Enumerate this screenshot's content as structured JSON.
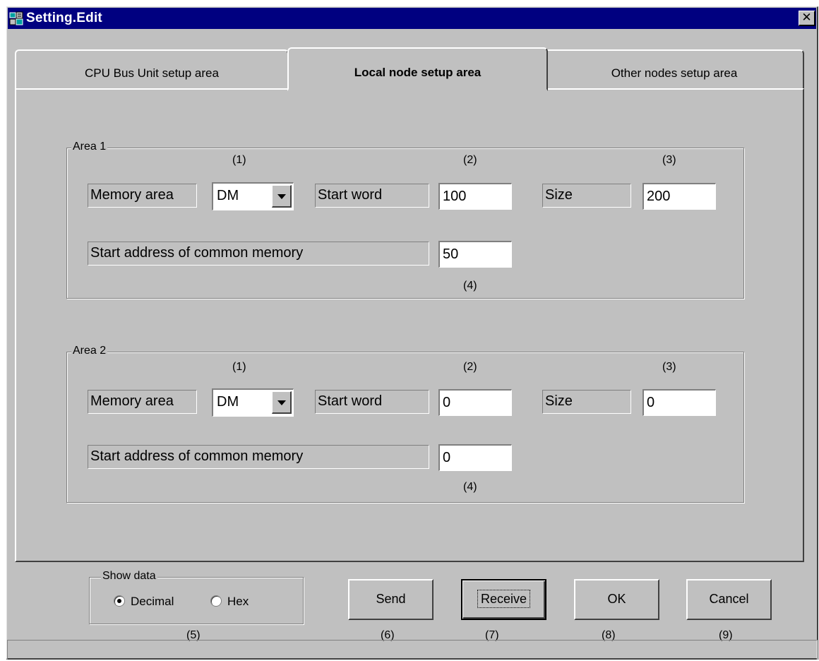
{
  "window": {
    "title": "Setting.Edit",
    "close_label": "✕"
  },
  "tabs": [
    {
      "label": "CPU Bus Unit setup area",
      "active": false
    },
    {
      "label": "Local node setup area",
      "active": true
    },
    {
      "label": "Other nodes setup area",
      "active": false
    }
  ],
  "areas": [
    {
      "label": "Area 1",
      "markers": {
        "m1": "(1)",
        "m2": "(2)",
        "m3": "(3)",
        "m4": "(4)"
      },
      "memory_area_label": "Memory area",
      "memory_area_value": "DM",
      "start_word_label": "Start word",
      "start_word_value": "100",
      "size_label": "Size",
      "size_value": "200",
      "common_memory_label": "Start address of common memory",
      "common_memory_value": "50"
    },
    {
      "label": "Area 2",
      "markers": {
        "m1": "(1)",
        "m2": "(2)",
        "m3": "(3)",
        "m4": "(4)"
      },
      "memory_area_label": "Memory area",
      "memory_area_value": "DM",
      "start_word_label": "Start word",
      "start_word_value": "0",
      "size_label": "Size",
      "size_value": "0",
      "common_memory_label": "Start address of common memory",
      "common_memory_value": "0"
    }
  ],
  "show_data": {
    "label": "Show data",
    "options": [
      {
        "label": "Decimal",
        "checked": true
      },
      {
        "label": "Hex",
        "checked": false
      }
    ],
    "marker": "(5)"
  },
  "buttons": {
    "send": "Send",
    "receive": "Receive",
    "ok": "OK",
    "cancel": "Cancel"
  },
  "markers_bottom": {
    "m6": "(6)",
    "m7": "(7)",
    "m8": "(8)",
    "m9": "(9)"
  },
  "colors": {
    "titlebar": "#000080",
    "face": "#c0c0c0"
  }
}
